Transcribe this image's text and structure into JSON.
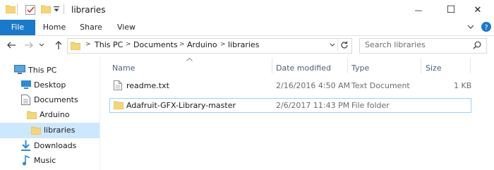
{
  "window": {
    "title": "libraries",
    "minimize_glyph": "—",
    "maximize_glyph": "☐",
    "close_glyph": "✕",
    "qat_icons": [
      "folder-icon",
      "properties-icon",
      "new-folder-icon",
      "customize-arrow-icon"
    ]
  },
  "ribbon": {
    "tabs": [
      {
        "label": "File",
        "active": true
      },
      {
        "label": "Home"
      },
      {
        "label": "Share"
      },
      {
        "label": "View"
      }
    ]
  },
  "addressbar": {
    "crumbs": [
      "This PC",
      "Documents",
      "Arduino",
      "libraries"
    ],
    "search_placeholder": "Search libraries"
  },
  "nav_pane": {
    "items": [
      {
        "label": "This PC",
        "icon": "computer-icon"
      },
      {
        "label": "Desktop",
        "icon": "desktop-icon"
      },
      {
        "label": "Documents",
        "icon": "documents-icon"
      },
      {
        "label": "Arduino",
        "icon": "folder-icon"
      },
      {
        "label": "libraries",
        "icon": "folder-icon",
        "selected": true
      },
      {
        "label": "Downloads",
        "icon": "downloads-icon"
      },
      {
        "label": "Music",
        "icon": "music-icon"
      }
    ]
  },
  "file_list": {
    "columns": [
      "Name",
      "Date modified",
      "Type",
      "Size"
    ],
    "rows": [
      {
        "name": "readme.txt",
        "date": "2/16/2016 4:50 AM",
        "type": "Text Document",
        "size": "1 KB",
        "icon": "text-file-icon"
      },
      {
        "name": "Adafruit-GFX-Library-master",
        "date": "2/6/2017 11:43 PM",
        "type": "File folder",
        "size": "",
        "icon": "folder-icon"
      }
    ]
  },
  "colors": {
    "accent": "#1979ca",
    "selection": "#cce8ff",
    "folder": "#f7d774",
    "header_text": "#4c607a"
  }
}
